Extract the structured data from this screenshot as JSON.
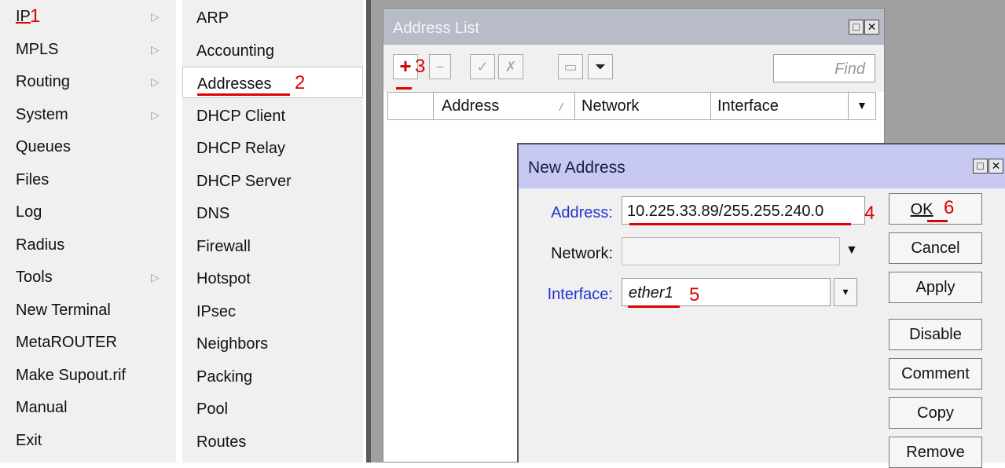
{
  "menu1": {
    "items": [
      {
        "label": "IP",
        "annot": "1",
        "arrow": true
      },
      {
        "label": "MPLS",
        "arrow": true
      },
      {
        "label": "Routing",
        "arrow": true
      },
      {
        "label": "System",
        "arrow": true
      },
      {
        "label": "Queues",
        "arrow": false
      },
      {
        "label": "Files",
        "arrow": false
      },
      {
        "label": "Log",
        "arrow": false
      },
      {
        "label": "Radius",
        "arrow": false
      },
      {
        "label": "Tools",
        "arrow": true
      },
      {
        "label": "New Terminal",
        "arrow": false
      },
      {
        "label": "MetaROUTER",
        "arrow": false
      },
      {
        "label": "Make Supout.rif",
        "arrow": false
      },
      {
        "label": "Manual",
        "arrow": false
      },
      {
        "label": "Exit",
        "arrow": false
      }
    ],
    "arrow_glyph": "▷"
  },
  "menu2": {
    "items": [
      {
        "label": "ARP"
      },
      {
        "label": "Accounting"
      },
      {
        "label": "Addresses",
        "annot": "2",
        "selected": true
      },
      {
        "label": "DHCP Client"
      },
      {
        "label": "DHCP Relay"
      },
      {
        "label": "DHCP Server"
      },
      {
        "label": "DNS"
      },
      {
        "label": "Firewall"
      },
      {
        "label": "Hotspot"
      },
      {
        "label": "IPsec"
      },
      {
        "label": "Neighbors"
      },
      {
        "label": "Packing"
      },
      {
        "label": "Pool"
      },
      {
        "label": "Routes"
      }
    ]
  },
  "address_list": {
    "title": "Address List",
    "add_annot": "3",
    "find_placeholder": "Find",
    "columns": [
      "Address",
      "Network",
      "Interface"
    ],
    "sort_glyph": "/"
  },
  "new_address": {
    "title": "New Address",
    "address_label": "Address:",
    "address_value": "10.225.33.89/255.255.240.0",
    "address_annot": "4",
    "network_label": "Network:",
    "network_value": "",
    "interface_label": "Interface:",
    "interface_value": "ether1",
    "interface_annot": "5",
    "buttons": {
      "ok": "OK",
      "ok_annot": "6",
      "cancel": "Cancel",
      "apply": "Apply",
      "disable": "Disable",
      "comment": "Comment",
      "copy": "Copy",
      "remove": "Remove"
    }
  },
  "colors": {
    "annotation": "#e00000",
    "field_label_blue": "#2233cc",
    "dialog_title_bg": "#c7c9f2"
  }
}
